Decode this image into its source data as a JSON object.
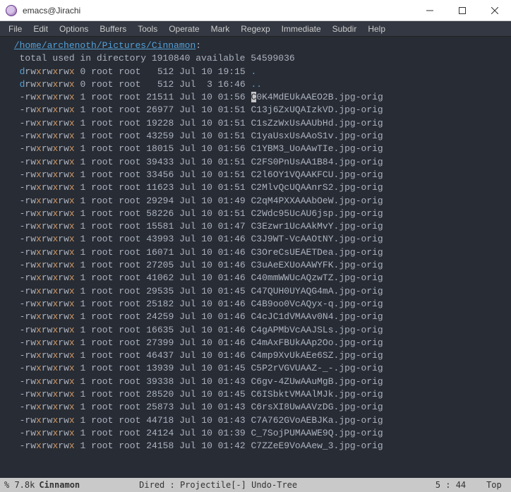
{
  "window": {
    "title": "emacs@Jirachi"
  },
  "menubar": [
    "File",
    "Edit",
    "Options",
    "Buffers",
    "Tools",
    "Operate",
    "Mark",
    "Regexp",
    "Immediate",
    "Subdir",
    "Help"
  ],
  "dired": {
    "path": "/home/archenoth/Pictures/Cinnamon",
    "total_line": "total used in directory 1910840 available 54599036",
    "entries": [
      {
        "perm": "drwxrwxrwx",
        "links": "0",
        "user": "root",
        "group": "root",
        "size": "512",
        "date": "Jul 10 19:15",
        "name": ".",
        "dir": true
      },
      {
        "perm": "drwxrwxrwx",
        "links": "0",
        "user": "root",
        "group": "root",
        "size": "512",
        "date": "Jul  3 16:46",
        "name": "..",
        "dir": true
      },
      {
        "perm": "-rwxrwxrwx",
        "links": "1",
        "user": "root",
        "group": "root",
        "size": "21511",
        "date": "Jul 10 01:56",
        "name": "C0K4MdEUkAAEO2B.jpg-orig",
        "cursor": true
      },
      {
        "perm": "-rwxrwxrwx",
        "links": "1",
        "user": "root",
        "group": "root",
        "size": "26977",
        "date": "Jul 10 01:51",
        "name": "C13j6ZxUQAIzkVD.jpg-orig"
      },
      {
        "perm": "-rwxrwxrwx",
        "links": "1",
        "user": "root",
        "group": "root",
        "size": "19228",
        "date": "Jul 10 01:51",
        "name": "C1sZzWxUsAAUbHd.jpg-orig"
      },
      {
        "perm": "-rwxrwxrwx",
        "links": "1",
        "user": "root",
        "group": "root",
        "size": "43259",
        "date": "Jul 10 01:51",
        "name": "C1yaUsxUsAAoS1v.jpg-orig"
      },
      {
        "perm": "-rwxrwxrwx",
        "links": "1",
        "user": "root",
        "group": "root",
        "size": "18015",
        "date": "Jul 10 01:56",
        "name": "C1YBM3_UoAAwTIe.jpg-orig"
      },
      {
        "perm": "-rwxrwxrwx",
        "links": "1",
        "user": "root",
        "group": "root",
        "size": "39433",
        "date": "Jul 10 01:51",
        "name": "C2FS0PnUsAA1B84.jpg-orig"
      },
      {
        "perm": "-rwxrwxrwx",
        "links": "1",
        "user": "root",
        "group": "root",
        "size": "33456",
        "date": "Jul 10 01:51",
        "name": "C2l6OY1VQAAKFCU.jpg-orig"
      },
      {
        "perm": "-rwxrwxrwx",
        "links": "1",
        "user": "root",
        "group": "root",
        "size": "11623",
        "date": "Jul 10 01:51",
        "name": "C2MlvQcUQAAnrS2.jpg-orig"
      },
      {
        "perm": "-rwxrwxrwx",
        "links": "1",
        "user": "root",
        "group": "root",
        "size": "29294",
        "date": "Jul 10 01:49",
        "name": "C2qM4PXXAAAbOeW.jpg-orig"
      },
      {
        "perm": "-rwxrwxrwx",
        "links": "1",
        "user": "root",
        "group": "root",
        "size": "58226",
        "date": "Jul 10 01:51",
        "name": "C2Wdc95UcAU6jsp.jpg-orig"
      },
      {
        "perm": "-rwxrwxrwx",
        "links": "1",
        "user": "root",
        "group": "root",
        "size": "15581",
        "date": "Jul 10 01:47",
        "name": "C3Ezwr1UcAAkMvY.jpg-orig"
      },
      {
        "perm": "-rwxrwxrwx",
        "links": "1",
        "user": "root",
        "group": "root",
        "size": "43993",
        "date": "Jul 10 01:46",
        "name": "C3J9WT-VcAAOtNY.jpg-orig"
      },
      {
        "perm": "-rwxrwxrwx",
        "links": "1",
        "user": "root",
        "group": "root",
        "size": "16071",
        "date": "Jul 10 01:46",
        "name": "C3OreCsUEAETDea.jpg-orig"
      },
      {
        "perm": "-rwxrwxrwx",
        "links": "1",
        "user": "root",
        "group": "root",
        "size": "27205",
        "date": "Jul 10 01:46",
        "name": "C3uAeEXUoAAWYFK.jpg-orig"
      },
      {
        "perm": "-rwxrwxrwx",
        "links": "1",
        "user": "root",
        "group": "root",
        "size": "41062",
        "date": "Jul 10 01:46",
        "name": "C40mmWWUcAQzwTZ.jpg-orig"
      },
      {
        "perm": "-rwxrwxrwx",
        "links": "1",
        "user": "root",
        "group": "root",
        "size": "29535",
        "date": "Jul 10 01:45",
        "name": "C47QUH0UYAQG4mA.jpg-orig"
      },
      {
        "perm": "-rwxrwxrwx",
        "links": "1",
        "user": "root",
        "group": "root",
        "size": "25182",
        "date": "Jul 10 01:46",
        "name": "C4B9oo0VcAQyx-q.jpg-orig"
      },
      {
        "perm": "-rwxrwxrwx",
        "links": "1",
        "user": "root",
        "group": "root",
        "size": "24259",
        "date": "Jul 10 01:46",
        "name": "C4cJC1dVMAAv0N4.jpg-orig"
      },
      {
        "perm": "-rwxrwxrwx",
        "links": "1",
        "user": "root",
        "group": "root",
        "size": "16635",
        "date": "Jul 10 01:46",
        "name": "C4gAPMbVcAAJSLs.jpg-orig"
      },
      {
        "perm": "-rwxrwxrwx",
        "links": "1",
        "user": "root",
        "group": "root",
        "size": "27399",
        "date": "Jul 10 01:46",
        "name": "C4mAxFBUkAAp2Oo.jpg-orig"
      },
      {
        "perm": "-rwxrwxrwx",
        "links": "1",
        "user": "root",
        "group": "root",
        "size": "46437",
        "date": "Jul 10 01:46",
        "name": "C4mp9XvUkAEe6SZ.jpg-orig"
      },
      {
        "perm": "-rwxrwxrwx",
        "links": "1",
        "user": "root",
        "group": "root",
        "size": "13939",
        "date": "Jul 10 01:45",
        "name": "C5P2rVGVUAAZ-_-.jpg-orig"
      },
      {
        "perm": "-rwxrwxrwx",
        "links": "1",
        "user": "root",
        "group": "root",
        "size": "39338",
        "date": "Jul 10 01:43",
        "name": "C6gv-4ZUwAAuMgB.jpg-orig"
      },
      {
        "perm": "-rwxrwxrwx",
        "links": "1",
        "user": "root",
        "group": "root",
        "size": "28520",
        "date": "Jul 10 01:45",
        "name": "C6ISbktVMAAlMJk.jpg-orig"
      },
      {
        "perm": "-rwxrwxrwx",
        "links": "1",
        "user": "root",
        "group": "root",
        "size": "25873",
        "date": "Jul 10 01:43",
        "name": "C6rsXI8UwAAVzDG.jpg-orig"
      },
      {
        "perm": "-rwxrwxrwx",
        "links": "1",
        "user": "root",
        "group": "root",
        "size": "44718",
        "date": "Jul 10 01:43",
        "name": "C7A762GVoAEBJKa.jpg-orig"
      },
      {
        "perm": "-rwxrwxrwx",
        "links": "1",
        "user": "root",
        "group": "root",
        "size": "24124",
        "date": "Jul 10 01:39",
        "name": "C_7SojPUMAAWE9Q.jpg-orig"
      },
      {
        "perm": "-rwxrwxrwx",
        "links": "1",
        "user": "root",
        "group": "root",
        "size": "24158",
        "date": "Jul 10 01:42",
        "name": "C7ZZeE9VoAAew_3.jpg-orig"
      }
    ]
  },
  "modeline": {
    "pct": "% 7.8k",
    "buffer": "Cinnamon",
    "modes": "Dired : Projectile[-] Undo-Tree",
    "pos": "5 : 44",
    "scroll": "Top"
  }
}
